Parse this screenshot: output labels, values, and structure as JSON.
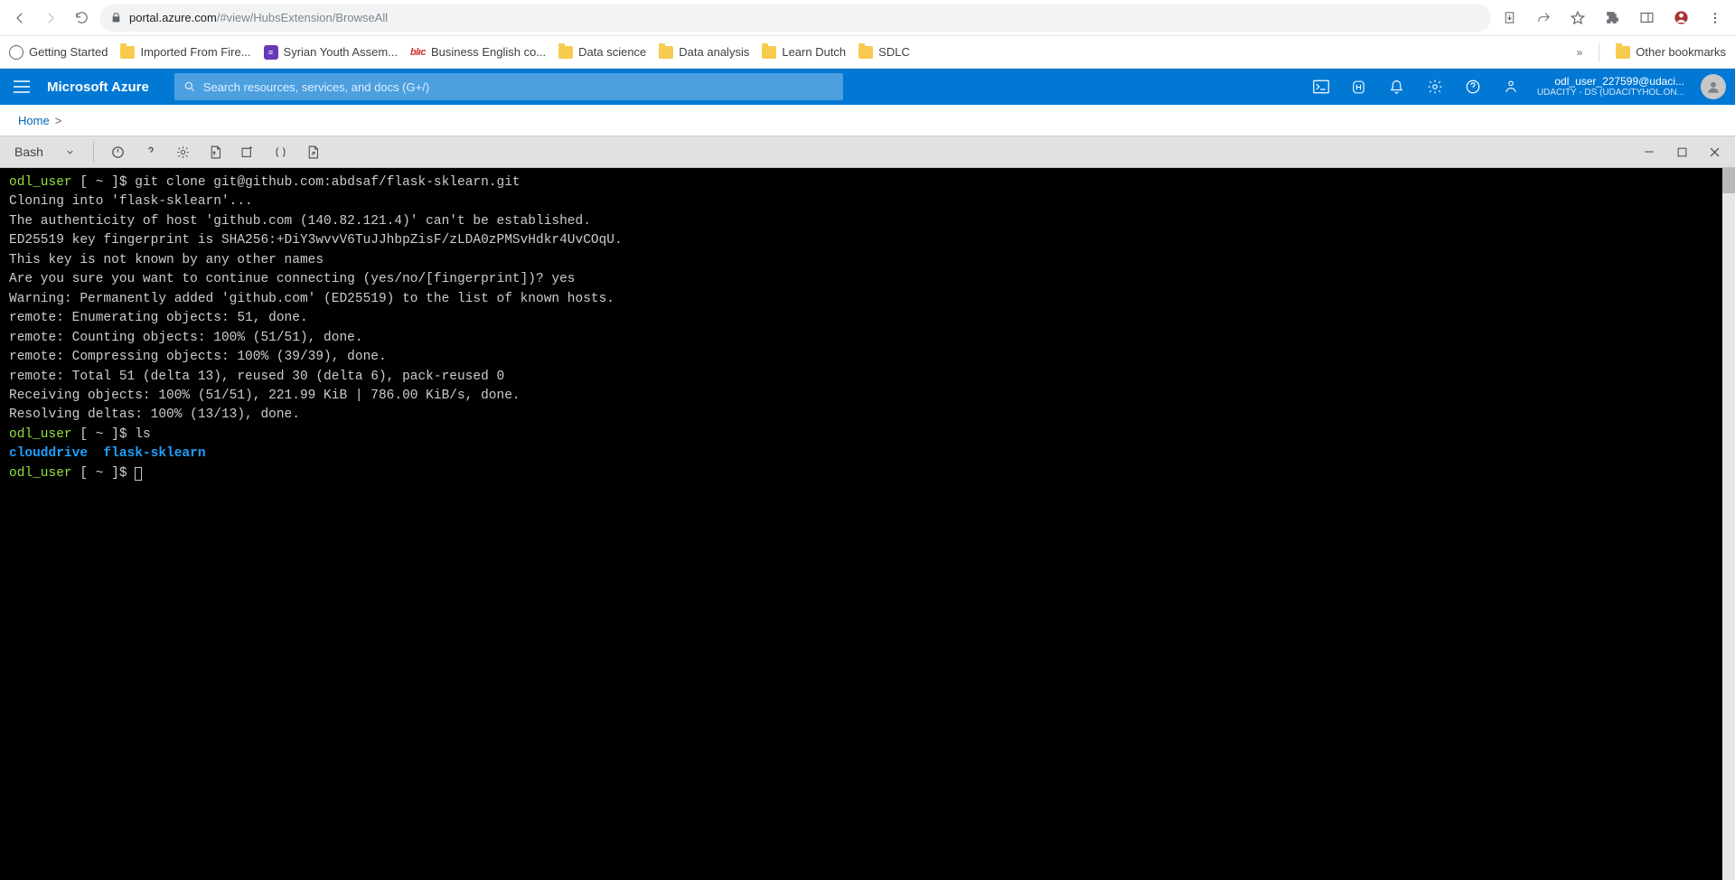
{
  "chrome": {
    "url_host": "portal.azure.com",
    "url_path": "/#view/HubsExtension/BrowseAll"
  },
  "bookmarks": {
    "items": [
      {
        "label": "Getting Started",
        "icon": "globe"
      },
      {
        "label": "Imported From Fire...",
        "icon": "folder"
      },
      {
        "label": "Syrian Youth Assem...",
        "icon": "purple"
      },
      {
        "label": "Business English co...",
        "icon": "blic"
      },
      {
        "label": "Data science",
        "icon": "folder"
      },
      {
        "label": "Data analysis",
        "icon": "folder"
      },
      {
        "label": "Learn Dutch",
        "icon": "folder"
      },
      {
        "label": "SDLC",
        "icon": "folder"
      }
    ],
    "more": "»",
    "other": "Other bookmarks"
  },
  "azure": {
    "brand": "Microsoft Azure",
    "search_placeholder": "Search resources, services, and docs (G+/)",
    "user_line1": "odl_user_227599@udaci...",
    "user_line2": "UDACITY - DS (UDACITYHOL.ON..."
  },
  "breadcrumb": {
    "home": "Home",
    "sep": ">"
  },
  "shell_toolbar": {
    "shell_type": "Bash"
  },
  "terminal": {
    "l1_user": "odl_user",
    "l1_mid": " [ ~ ]$ ",
    "l1_cmd": "git clone git@github.com:abdsaf/flask-sklearn.git",
    "l2": "Cloning into 'flask-sklearn'...",
    "l3": "The authenticity of host 'github.com (140.82.121.4)' can't be established.",
    "l4": "ED25519 key fingerprint is SHA256:+DiY3wvvV6TuJJhbpZisF/zLDA0zPMSvHdkr4UvCOqU.",
    "l5": "This key is not known by any other names",
    "l6": "Are you sure you want to continue connecting (yes/no/[fingerprint])? yes",
    "l7": "Warning: Permanently added 'github.com' (ED25519) to the list of known hosts.",
    "l8": "remote: Enumerating objects: 51, done.",
    "l9": "remote: Counting objects: 100% (51/51), done.",
    "l10": "remote: Compressing objects: 100% (39/39), done.",
    "l11": "remote: Total 51 (delta 13), reused 30 (delta 6), pack-reused 0",
    "l12": "Receiving objects: 100% (51/51), 221.99 KiB | 786.00 KiB/s, done.",
    "l13": "Resolving deltas: 100% (13/13), done.",
    "l14_user": "odl_user",
    "l14_mid": " [ ~ ]$ ",
    "l14_cmd": "ls",
    "l15_a": "clouddrive",
    "l15_b": "flask-sklearn",
    "l16_user": "odl_user",
    "l16_mid": " [ ~ ]$ "
  }
}
